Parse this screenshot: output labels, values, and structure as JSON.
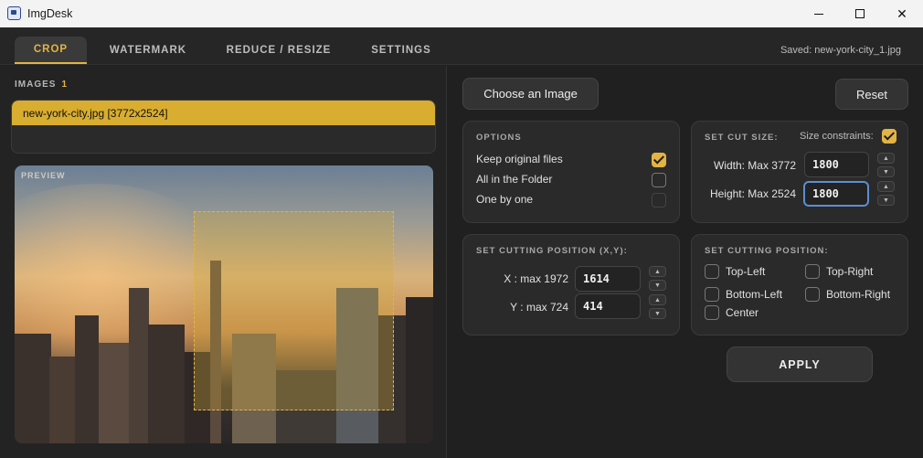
{
  "window": {
    "title": "ImgDesk",
    "minimize_icon": "minimize-icon",
    "maximize_icon": "maximize-icon",
    "close_icon": "close-icon"
  },
  "nav": {
    "tabs": [
      {
        "label": "CROP",
        "active": true
      },
      {
        "label": "WATERMARK",
        "active": false
      },
      {
        "label": "REDUCE / RESIZE",
        "active": false
      },
      {
        "label": "SETTINGS",
        "active": false
      }
    ],
    "saved_status": "Saved: new-york-city_1.jpg"
  },
  "images": {
    "header": "IMAGES",
    "count": "1",
    "files": [
      {
        "label": "new-york-city.jpg [3772x2524]",
        "selected": true
      }
    ]
  },
  "preview": {
    "label": "PREVIEW"
  },
  "buttons": {
    "choose": "Choose an Image",
    "reset": "Reset",
    "apply": "APPLY"
  },
  "options": {
    "title": "OPTIONS",
    "items": [
      {
        "label": "Keep original files",
        "checked": true
      },
      {
        "label": "All in the Folder",
        "checked": false
      },
      {
        "label": "One by one",
        "checked": false
      }
    ]
  },
  "cut_size": {
    "title": "SET CUT SIZE:",
    "constraints_label": "Size constraints:",
    "constraints_checked": true,
    "width_label": "Width: Max 3772",
    "width_value": "1800",
    "height_label": "Height: Max 2524",
    "height_value": "1800"
  },
  "cutting_position_xy": {
    "title": "SET CUTTING POSITION (X,Y):",
    "x_label": "X : max 1972",
    "x_value": "1614",
    "y_label": "Y : max 724",
    "y_value": "414"
  },
  "cutting_position": {
    "title": "SET CUTTING POSITION:",
    "top_left": "Top-Left",
    "top_right": "Top-Right",
    "bottom_left": "Bottom-Left",
    "bottom_right": "Bottom-Right",
    "center": "Center"
  },
  "spinner": {
    "up": "▲",
    "down": "▼"
  },
  "colors": {
    "accent": "#e3b443",
    "background": "#202020",
    "focus": "#5b8fd0"
  }
}
